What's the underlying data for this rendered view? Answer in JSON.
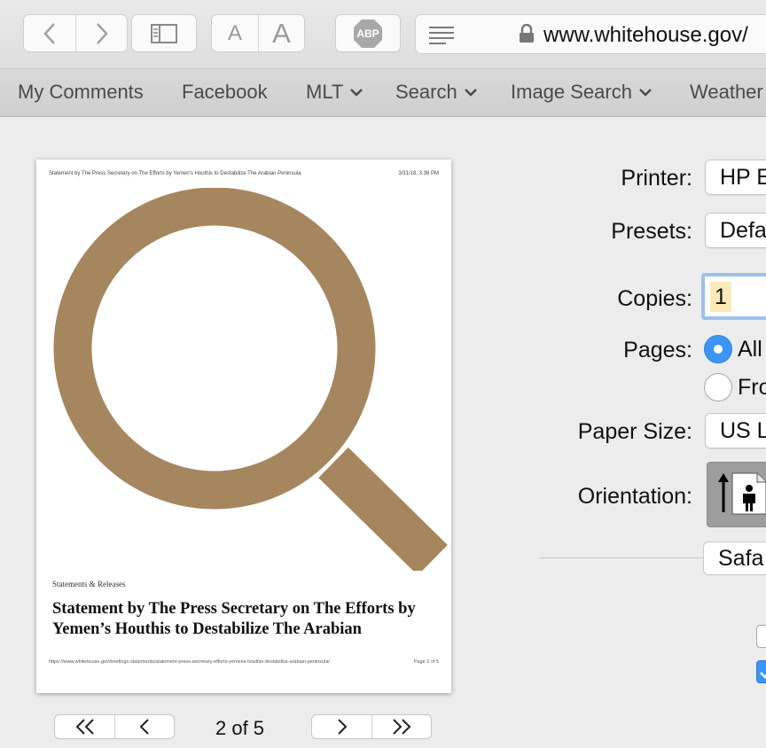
{
  "toolbar": {
    "back_icon": "chevron-left-icon",
    "forward_icon": "chevron-right-icon",
    "sidebar_icon": "sidebar-icon",
    "font_small": "A",
    "font_large": "A",
    "adblock_label": "ABP",
    "reader_icon": "reader-lines-icon",
    "lock_icon": "lock-icon",
    "url": "www.whitehouse.gov/"
  },
  "bookmarks": {
    "items": [
      {
        "label": "My Comments",
        "has_menu": false
      },
      {
        "label": "Facebook",
        "has_menu": false
      },
      {
        "label": "MLT",
        "has_menu": true
      },
      {
        "label": "Search",
        "has_menu": true
      },
      {
        "label": "Image Search",
        "has_menu": true
      },
      {
        "label": "Weather",
        "has_menu": false
      }
    ]
  },
  "preview": {
    "header_left": "Statement by The Press Secretary on The Efforts by Yemen's Houthis to Destabilize The Arabian Peninsula",
    "header_right": "3/31/18, 3:36 PM",
    "category": "Statements & Releases",
    "title": "Statement by The Press Secretary on The Efforts by Yemen’s Houthis to Destabilize The Arabian",
    "footer_url": "https://www.whitehouse.gov/briefings-statements/statement-press-secretary-efforts-yemens-houthis-destabilize-arabian-peninsula/",
    "footer_page": "Page 2 of 5",
    "graphic_color": "#a6865e"
  },
  "page_nav": {
    "indicator": "2 of 5",
    "first_icon": "double-chevron-left-icon",
    "prev_icon": "chevron-left-icon",
    "next_icon": "chevron-right-icon",
    "last_icon": "double-chevron-right-icon"
  },
  "print_settings": {
    "printer_label": "Printer:",
    "printer_value": "HP E",
    "presets_label": "Presets:",
    "presets_value": "Defa",
    "copies_label": "Copies:",
    "copies_value": "1",
    "pages_label": "Pages:",
    "pages_all": "All",
    "pages_from": "Fro",
    "paper_size_label": "Paper Size:",
    "paper_size_value": "US L",
    "orientation_label": "Orientation:",
    "orientation_icon": "portrait-person-icon",
    "section_value": "Safa",
    "accent_color": "#3b95f5"
  }
}
